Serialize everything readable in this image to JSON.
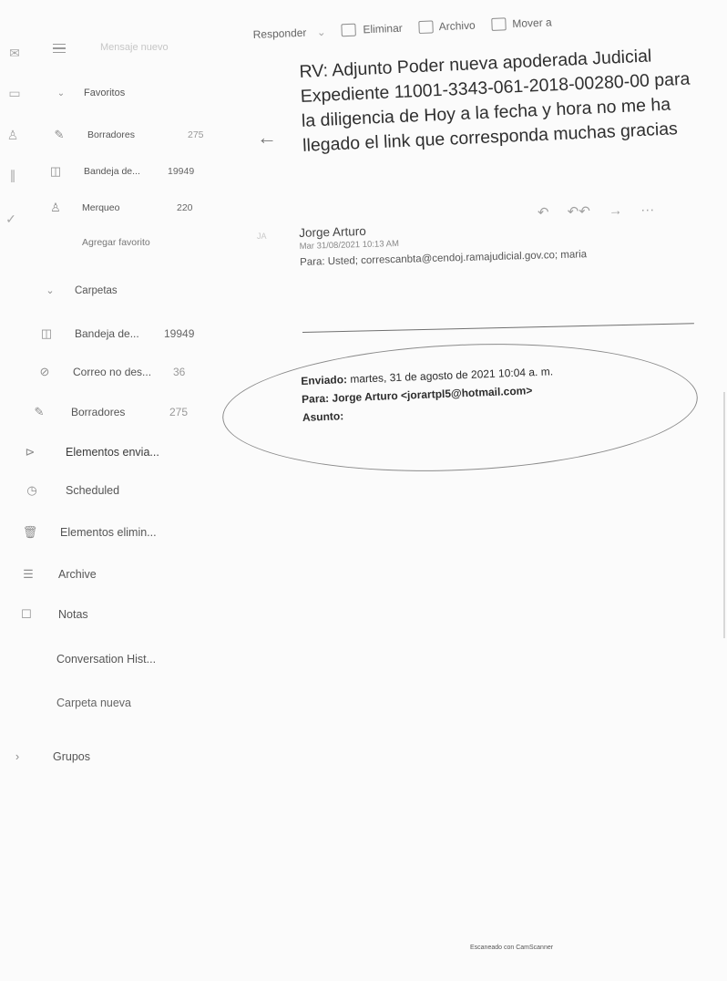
{
  "toolbar": {
    "reply_label": "Responder",
    "delete_label": "Eliminar",
    "archive_label": "Archivo",
    "move_label": "Mover a"
  },
  "sidebar": {
    "new_message": "Mensaje nuevo",
    "favorites": {
      "header": "Favoritos",
      "items": [
        {
          "label": "Borradores",
          "count": "275",
          "icon": "pencil-icon"
        },
        {
          "label": "Bandeja de...",
          "count": "19949",
          "icon": "inbox-icon"
        },
        {
          "label": "Merqueo",
          "count": "220",
          "icon": "person-icon"
        }
      ],
      "add_favorite": "Agregar favorito"
    },
    "folders": {
      "header": "Carpetas",
      "items": [
        {
          "label": "Bandeja de...",
          "count": "19949",
          "icon": "inbox-icon"
        },
        {
          "label": "Correo no des...",
          "count": "36",
          "icon": "blocked-icon"
        },
        {
          "label": "Borradores",
          "count": "275",
          "icon": "pencil-icon"
        },
        {
          "label": "Elementos envia...",
          "count": "",
          "icon": "send-icon"
        },
        {
          "label": "Scheduled",
          "count": "",
          "icon": "clock-icon"
        },
        {
          "label": "Elementos elimin...",
          "count": "",
          "icon": "trash-icon"
        },
        {
          "label": "Archive",
          "count": "",
          "icon": "archive-icon"
        },
        {
          "label": "Notas",
          "count": "",
          "icon": "note-icon"
        },
        {
          "label": "Conversation Hist...",
          "count": "",
          "icon": ""
        },
        {
          "label": "Carpeta nueva",
          "count": "",
          "icon": ""
        }
      ]
    },
    "groups": "Grupos"
  },
  "message": {
    "subject": "RV: Adjunto Poder nueva apoderada Judicial Expediente 11001-3343-061-2018-00280-00 para la diligencia de Hoy a la fecha y hora no me ha llegado el link que corresponda muchas gracias",
    "avatar_initials": "JA",
    "sender_name": "Jorge Arturo",
    "sent_date": "Mar 31/08/2021 10:13 AM",
    "to_line": "Para:  Usted; correscanbta@cendoj.ramajudicial.gov.co; maria"
  },
  "forwarded": {
    "sent_label": "Enviado:",
    "sent_value": "martes, 31 de agosto de 2021 10:04 a. m.",
    "to_label": "Para:",
    "to_value": "Jorge Arturo <jorartpl5@hotmail.com>",
    "subject_label": "Asunto:"
  },
  "footer": {
    "scanner_text": "Escaneado con CamScanner"
  }
}
